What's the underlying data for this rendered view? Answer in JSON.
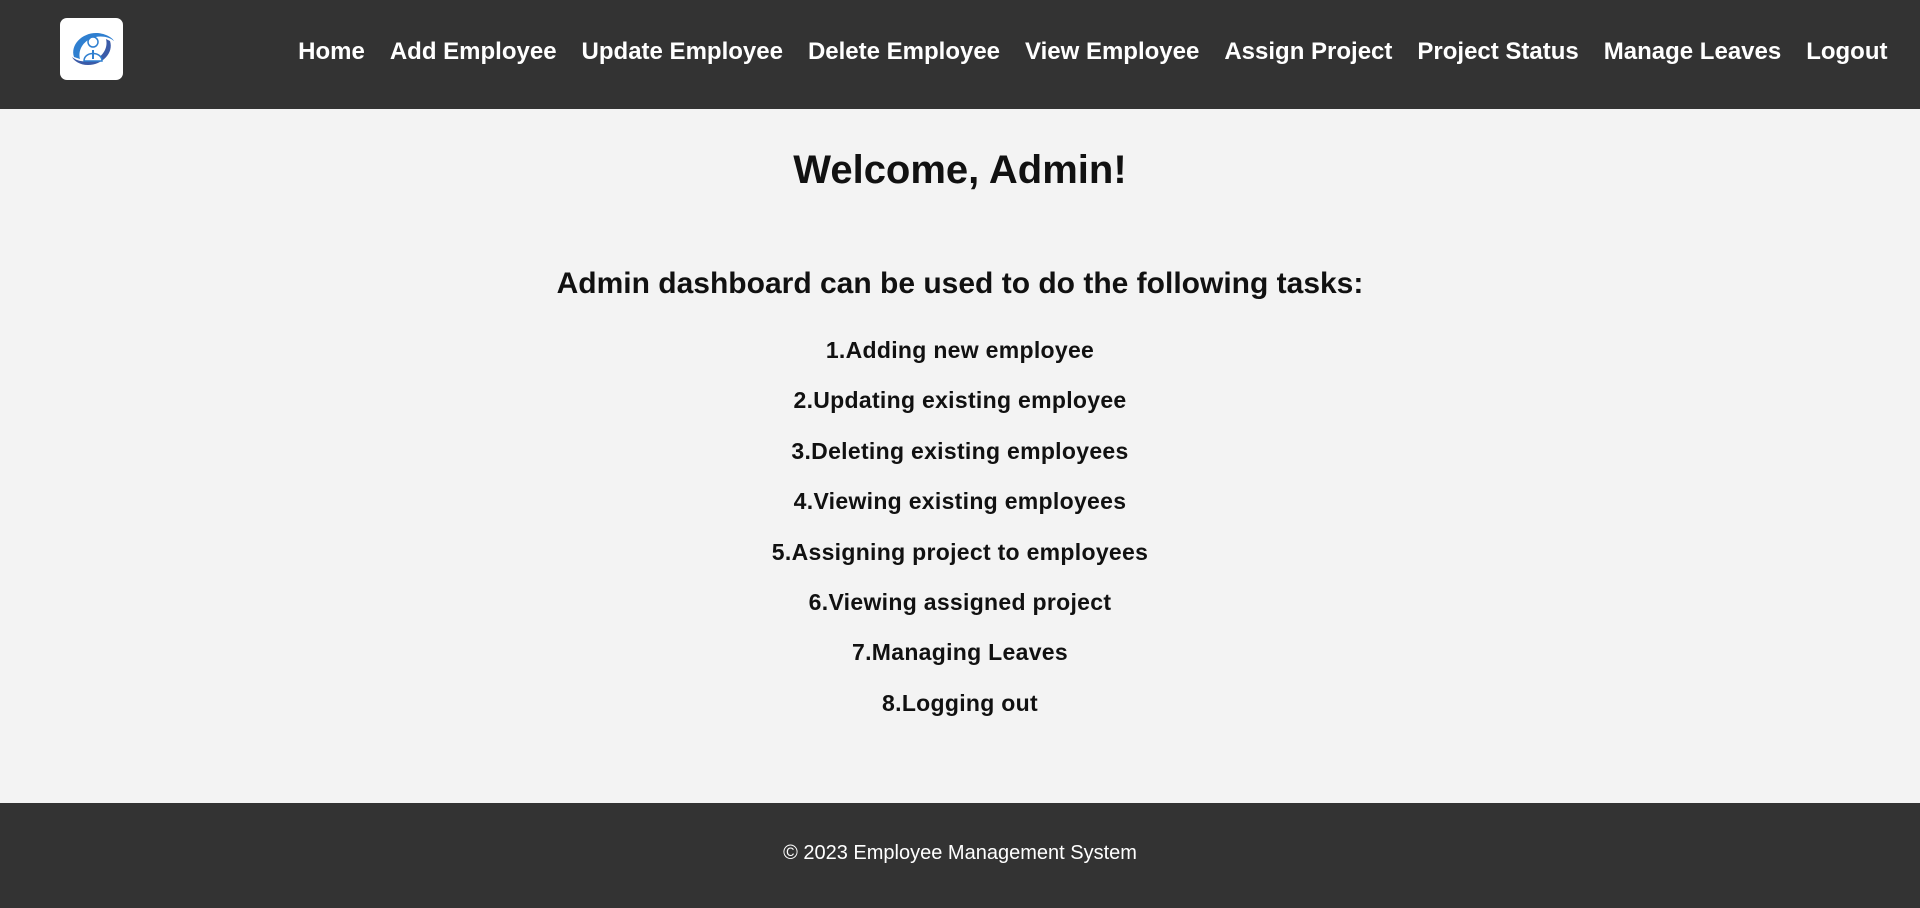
{
  "header": {
    "logo": {
      "icon": "employee-gear-logo-icon",
      "accent": "#2f7fd0"
    },
    "nav": [
      {
        "label": "Home"
      },
      {
        "label": "Add Employee"
      },
      {
        "label": "Update Employee"
      },
      {
        "label": "Delete Employee"
      },
      {
        "label": "View Employee"
      },
      {
        "label": "Assign Project"
      },
      {
        "label": "Project Status"
      },
      {
        "label": "Manage Leaves"
      },
      {
        "label": "Logout"
      }
    ]
  },
  "main": {
    "title": "Welcome, Admin!",
    "subtitle": "Admin dashboard can be used to do the following tasks:",
    "tasks": [
      "1.Adding new employee",
      "2.Updating existing employee",
      "3.Deleting existing employees",
      "4.Viewing existing employees",
      "5.Assigning project to employees",
      "6.Viewing assigned project",
      "7.Managing Leaves",
      "8.Logging out"
    ]
  },
  "footer": {
    "text": "© 2023 Employee Management System"
  },
  "colors": {
    "header_bg": "#333333",
    "footer_bg": "#333333",
    "page_bg": "#f3f3f3",
    "nav_text": "#ffffff"
  }
}
